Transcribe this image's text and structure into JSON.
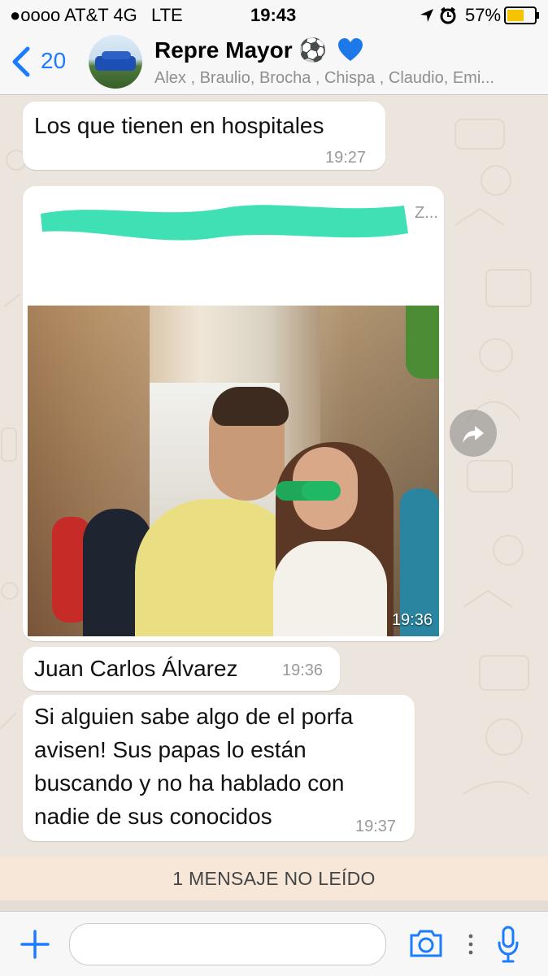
{
  "status": {
    "carrier": "●oooo AT&T 4G",
    "network": "LTE",
    "time": "19:43",
    "battery": "57%"
  },
  "header": {
    "back_count": "20",
    "title": "Repre Mayor ⚽",
    "members": "Alex , Braulio, Brocha , Chispa , Claudio, Emi..."
  },
  "messages": [
    {
      "text": "Los que tienen en hospitales",
      "time": "19:27"
    },
    {
      "link_preview_text": "Z...",
      "time": "19:36"
    },
    {
      "text": "Juan Carlos Álvarez",
      "time": "19:36"
    },
    {
      "text_lines": [
        "Si alguien sabe algo de el porfa",
        "avisen! Sus papas lo están",
        "buscando y no ha hablado con",
        "nadie de sus conocidos"
      ],
      "time": "19:37"
    }
  ],
  "unread_banner": "1 MENSAJE NO LEÍDO",
  "composer": {
    "placeholder": ""
  },
  "colors": {
    "accent_blue": "#1b7cff",
    "chat_background": "#ece5dd",
    "unread_banner": "#f6e7d9",
    "redaction_mark": "#40e0b5"
  },
  "icons": [
    "back-chevron-icon",
    "soccer-ball-icon",
    "heart-icon",
    "location-arrow-icon",
    "alarm-icon",
    "battery-icon",
    "forward-arrow-icon",
    "plus-icon",
    "camera-icon",
    "vertical-dots-icon",
    "microphone-icon"
  ]
}
